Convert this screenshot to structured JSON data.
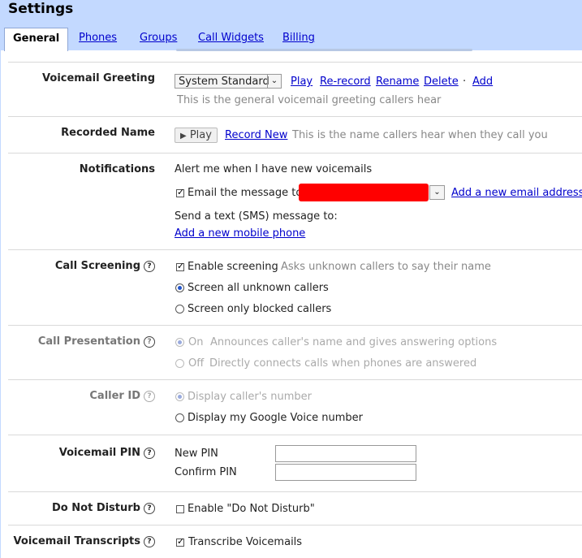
{
  "header": {
    "title": "Settings"
  },
  "tabs": [
    {
      "label": "General",
      "active": true
    },
    {
      "label": "Phones"
    },
    {
      "label": "Groups"
    },
    {
      "label": "Call Widgets"
    },
    {
      "label": "Billing"
    }
  ],
  "voicemail_greeting": {
    "label": "Voicemail Greeting",
    "selected": "System Standard",
    "actions": [
      "Play",
      "Re-record",
      "Rename",
      "Delete",
      "Add"
    ],
    "separator": "·",
    "description": "This is the general voicemail greeting callers hear"
  },
  "recorded_name": {
    "label": "Recorded Name",
    "play_label": "Play",
    "record_new": "Record New",
    "description": "This is the name callers hear when they call you"
  },
  "notifications": {
    "label": "Notifications",
    "alert_text": "Alert me when I have new voicemails",
    "email_label": "Email the message to:",
    "add_email": "Add a new email address",
    "sms_label": "Send a text (SMS) message to:",
    "add_phone": "Add a new mobile phone"
  },
  "call_screening": {
    "label": "Call Screening",
    "enable": "Enable screening",
    "enable_desc": "Asks unknown callers to say their name",
    "opt_all": "Screen all unknown callers",
    "opt_blocked": "Screen only blocked callers"
  },
  "call_presentation": {
    "label": "Call Presentation",
    "on": "On",
    "on_desc": "Announces caller's name and gives answering options",
    "off": "Off",
    "off_desc": "Directly connects calls when phones are answered"
  },
  "caller_id": {
    "label": "Caller ID",
    "opt_caller": "Display caller's number",
    "opt_gv": "Display my Google Voice number"
  },
  "voicemail_pin": {
    "label": "Voicemail PIN",
    "new_pin": "New PIN",
    "confirm_pin": "Confirm PIN",
    "new_pin_value": "",
    "confirm_pin_value": ""
  },
  "do_not_disturb": {
    "label": "Do Not Disturb",
    "option": "Enable \"Do Not Disturb\""
  },
  "voicemail_transcripts": {
    "label": "Voicemail Transcripts",
    "option": "Transcribe Voicemails"
  },
  "icons": {
    "help": "?",
    "play": "▶",
    "dropdown": "⌄"
  },
  "colors": {
    "header_bg": "#c3d9ff",
    "link": "#0000cc",
    "redaction": "#ff0000"
  }
}
